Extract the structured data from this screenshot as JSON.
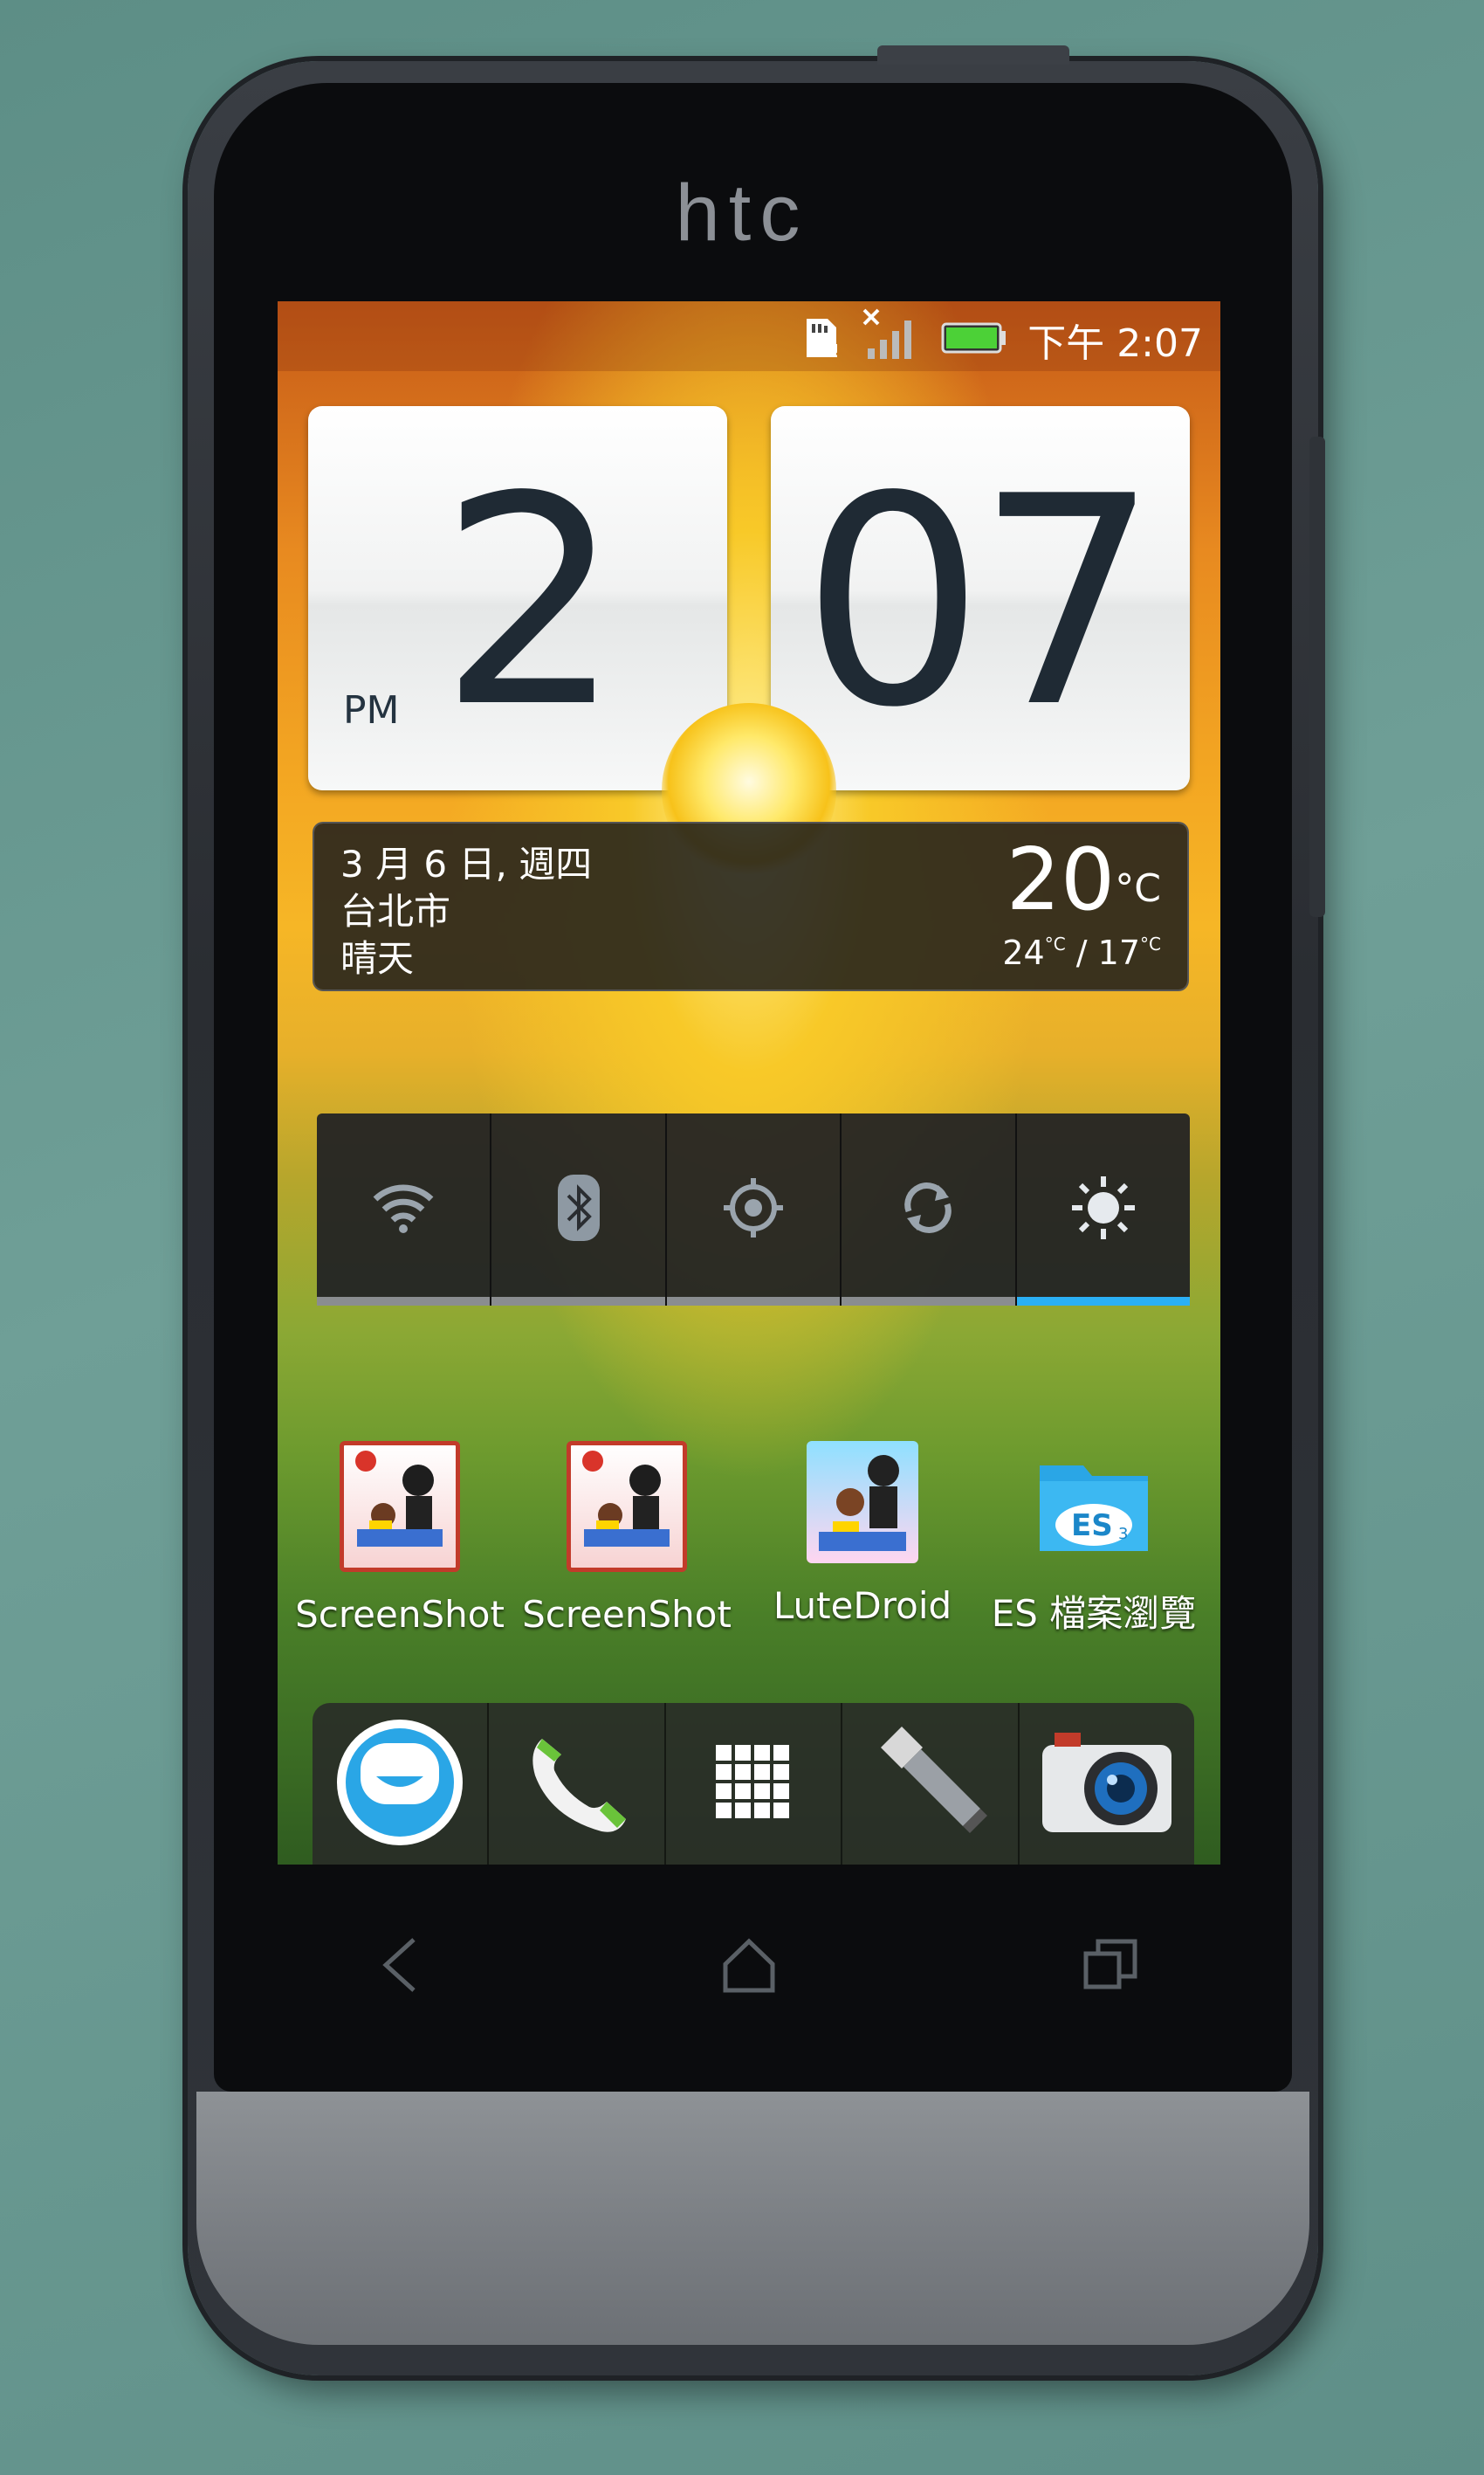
{
  "device": {
    "brand_logo": "htc"
  },
  "statusbar": {
    "time": "下午 2:07",
    "icons": [
      "sd-card-icon",
      "no-signal-icon",
      "battery-icon"
    ]
  },
  "clock_widget": {
    "hour": "2",
    "minute": "07",
    "ampm": "PM"
  },
  "weather_widget": {
    "date": "3 月 6 日, 週四",
    "city": "台北市",
    "condition": "晴天",
    "temperature": "20",
    "temp_unit": "°C",
    "high": "24",
    "low": "17",
    "range_unit": "°C",
    "range_sep": " / ",
    "icon": "sun-icon"
  },
  "quick_toggles": [
    {
      "name": "wifi-toggle",
      "icon": "wifi-icon",
      "on": false
    },
    {
      "name": "bluetooth-toggle",
      "icon": "bluetooth-icon",
      "on": false
    },
    {
      "name": "gps-toggle",
      "icon": "gps-icon",
      "on": false
    },
    {
      "name": "sync-toggle",
      "icon": "sync-icon",
      "on": false
    },
    {
      "name": "brightness-toggle",
      "icon": "brightness-icon",
      "on": true
    }
  ],
  "apps": [
    {
      "label": "ScreenShot",
      "icon": "screenshot-app-icon"
    },
    {
      "label": "ScreenShot",
      "icon": "screenshot-app-icon"
    },
    {
      "label": "LuteDroid",
      "icon": "lutedroid-app-icon"
    },
    {
      "label": "ES 檔案瀏覽",
      "icon": "es-file-explorer-icon"
    }
  ],
  "dock": [
    {
      "name": "people",
      "icon": "people-icon"
    },
    {
      "name": "phone",
      "icon": "phone-icon"
    },
    {
      "name": "all-apps",
      "icon": "apps-grid-icon"
    },
    {
      "name": "flashlight",
      "icon": "flashlight-icon"
    },
    {
      "name": "camera",
      "icon": "camera-icon"
    }
  ],
  "nav": [
    "back-icon",
    "home-icon",
    "recents-icon"
  ],
  "colors": {
    "toggle_on": "#2bb0f5",
    "toggle_off": "#8a8d90",
    "battery": "#4cd137"
  }
}
